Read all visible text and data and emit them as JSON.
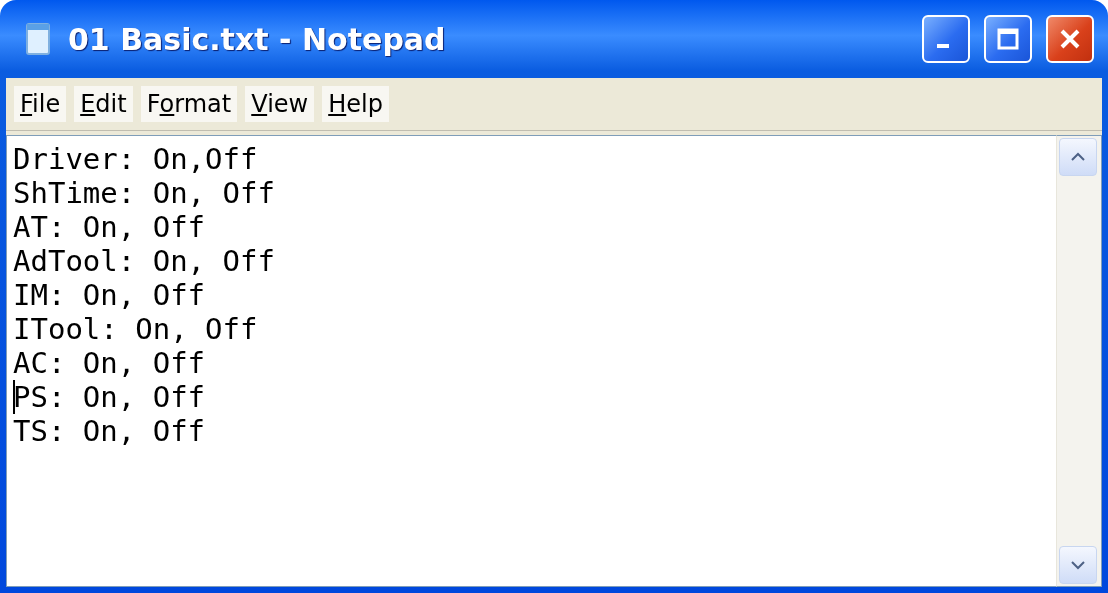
{
  "window": {
    "title": "01 Basic.txt - Notepad"
  },
  "menu": [
    {
      "key": "F",
      "post": "ile"
    },
    {
      "key": "E",
      "post": "dit"
    },
    {
      "pre": "F",
      "key": "o",
      "post": "rmat"
    },
    {
      "key": "V",
      "post": "iew"
    },
    {
      "key": "H",
      "post": "elp"
    }
  ],
  "lines": [
    {
      "text": "Driver: On,Off",
      "cursor": false
    },
    {
      "text": "ShTime: On, Off",
      "cursor": false
    },
    {
      "text": "AT: On, Off",
      "cursor": false
    },
    {
      "text": "AdTool: On, Off",
      "cursor": false
    },
    {
      "text": "IM: On, Off",
      "cursor": false
    },
    {
      "text": "ITool: On, Off",
      "cursor": false
    },
    {
      "text": "AC: On, Off",
      "cursor": false
    },
    {
      "text": "PS: On, Off",
      "cursor": true
    },
    {
      "text": "TS: On, Off",
      "cursor": false
    }
  ]
}
